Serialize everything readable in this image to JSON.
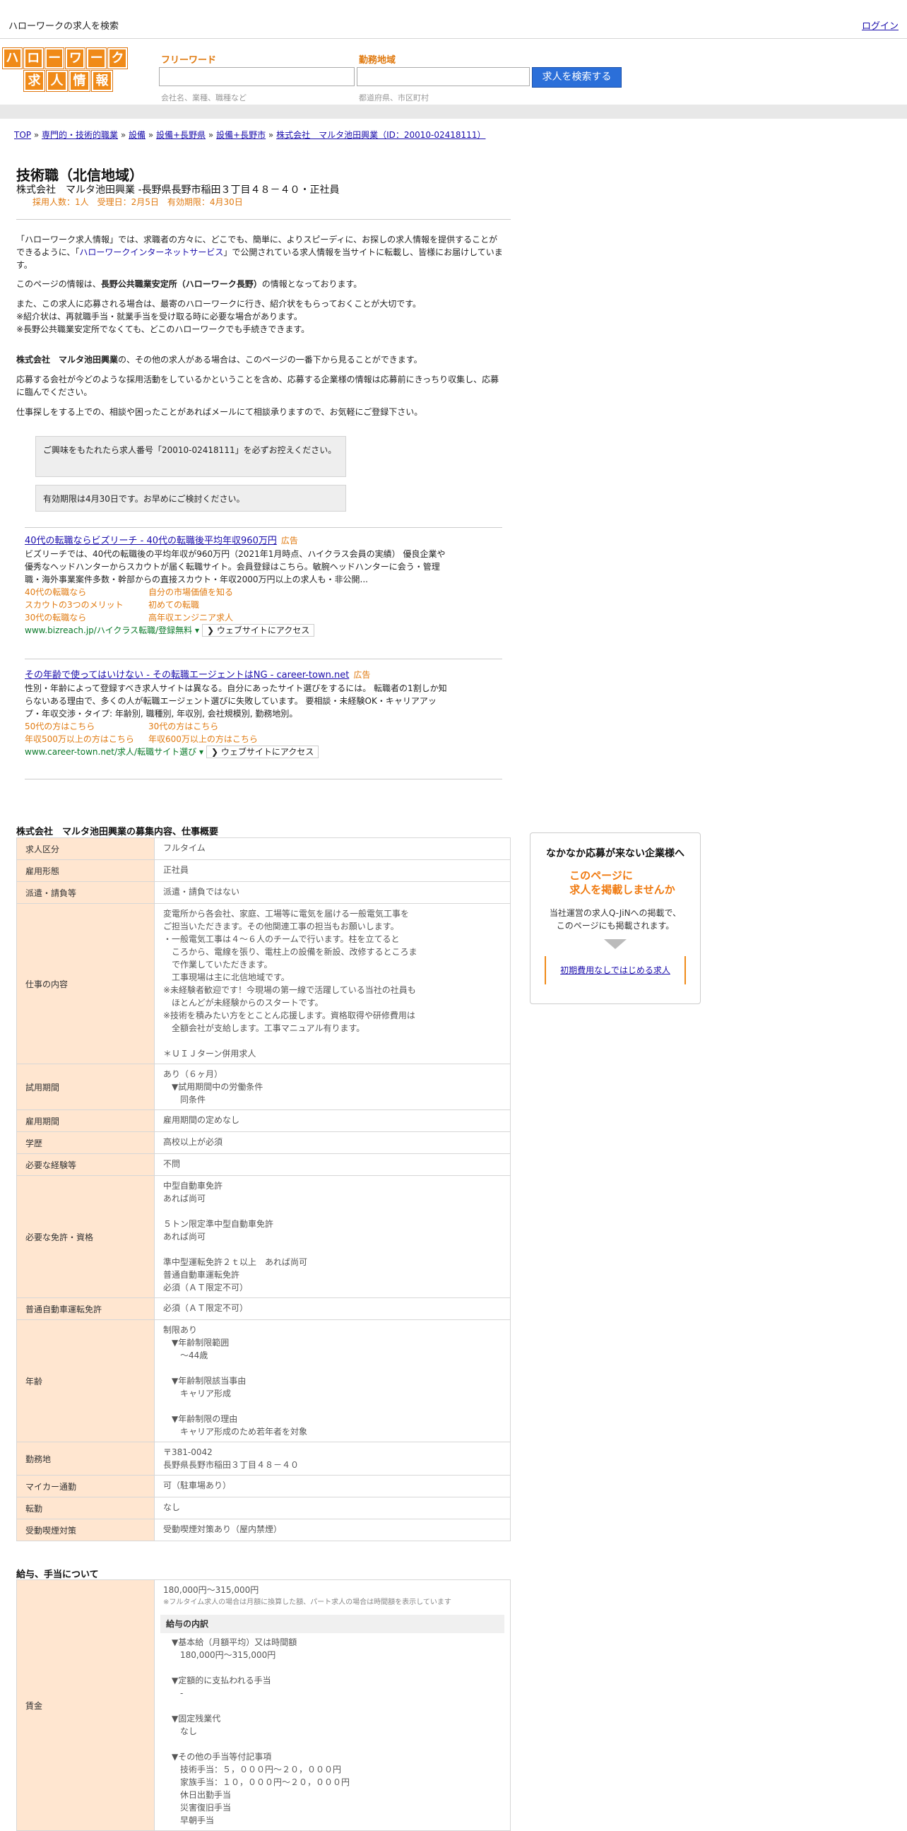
{
  "header": {
    "site_title": "ハローワークの求人を検索",
    "login": "ログイン",
    "logo_row1": [
      "ハ",
      "ロ",
      "ー",
      "ワ",
      "ー",
      "ク"
    ],
    "logo_row2": [
      "求",
      "人",
      "情",
      "報"
    ]
  },
  "search": {
    "freeword_label": "フリーワード",
    "freeword_hint": "会社名、業種、職種など",
    "area_label": "勤務地域",
    "area_hint": "都道府県、市区町村",
    "button": "求人を検索する"
  },
  "breadcrumb": [
    "TOP",
    "専門的・技術的職業",
    "設備",
    "設備+長野県",
    "設備+長野市",
    "株式会社　マルタ池田興業（ID：20010-02418111）"
  ],
  "job": {
    "title": "技術職（北信地域）",
    "company_line": "株式会社　マルタ池田興業 -長野県長野市稲田３丁目４８－４０・正社員",
    "meta": "採用人数：1人　受理日：2月5日　有効期限：4月30日"
  },
  "intro": {
    "p1_a": "「ハローワーク求人情報」では、求職者の方々に、どこでも、簡単に、よりスピーディに、お探しの求人情報を提供することができるように、「",
    "p1_link": "ハローワークインターネットサービス",
    "p1_b": "」で公開されている求人情報を当サイトに転載し、皆様にお届けしています。",
    "p2_a": "このページの情報は、",
    "p2_bold": "長野公共職業安定所（ハローワーク長野）",
    "p2_b": "の情報となっております。",
    "p3": "また、この求人に応募される場合は、最寄のハローワークに行き、紹介状をもらっておくことが大切です。",
    "p4": "※紹介状は、再就職手当・就業手当を受け取る時に必要な場合があります。",
    "p5": "※長野公共職業安定所でなくても、どこのハローワークでも手続きできます。",
    "p6_bold": "株式会社　マルタ池田興業",
    "p6": "の、その他の求人がある場合は、このページの一番下から見ることができます。",
    "p7": "応募する会社が今どのような採用活動をしているかということを含め、応募する企業様の情報は応募前にきっちり収集し、応募に臨んでください。",
    "p8": "仕事探しをする上での、相談や困ったことがあればメールにて相談承りますので、お気軽にご登録下さい。"
  },
  "notices": {
    "n1": "ご興味をもたれたら求人番号「20010-02418111」を必ずお控えください。",
    "n2": "有効期限は4月30日です。お早めにご検討ください。"
  },
  "ads": [
    {
      "title": "40代の転職ならビズリーチ - 40代の転職後平均年収960万円",
      "tag": "広告",
      "body": "ビズリーチでは、40代の転職後の平均年収が960万円（2021年1月時点、ハイクラス会員の実績） 優良企業や優秀なヘッドハンターからスカウトが届く転職サイト。会員登録はこちら。敏腕ヘッドハンターに会う・管理職・海外事業案件多数・幹部からの直接スカウト・年収2000万円以上の求人も・非公開...",
      "links": [
        "40代の転職なら",
        "自分の市場価値を知る",
        "スカウトの3つのメリット",
        "初めての転職",
        "30代の転職なら",
        "高年収エンジニア求人"
      ],
      "url": "www.bizreach.jp/ハイクラス転職/登録無料",
      "visit": "❯ ウェブサイトにアクセス"
    },
    {
      "title": "その年齢で使ってはいけない - その転職エージェントはNG - career-town.net",
      "tag": "広告",
      "body": "性別・年齢によって登録すべき求人サイトは異なる。自分にあったサイト選びをするには。 転職者の1割しか知らないある理由で、多くの人が転職エージェント選びに失敗しています。 要相談・未経験OK・キャリアアップ・年収交渉・タイプ: 年齢別, 職種別, 年収別, 会社規模別, 勤務地別。",
      "links": [
        "50代の方はこちら",
        "30代の方はこちら",
        "年収500万以上の方はこちら",
        "年収600万以上の方はこちら"
      ],
      "url": "www.career-town.net/求人/転職サイト選び",
      "visit": "❯ ウェブサイトにアクセス"
    }
  ],
  "details": {
    "section_title": "株式会社　マルタ池田興業の募集内容、仕事概要",
    "rows": [
      {
        "label": "求人区分",
        "value": "フルタイム"
      },
      {
        "label": "雇用形態",
        "value": "正社員"
      },
      {
        "label": "派遣・請負等",
        "value": "派遣・請負ではない"
      },
      {
        "label": "仕事の内容",
        "value": "変電所から各会社、家庭、工場等に電気を届ける一般電気工事を\nご担当いただきます。その他関連工事の担当もお願いします。\n・一般電気工事は４～６人のチームで行います。柱を立てると\n　ころから、電線を張り、電柱上の設備を新設、改修するところま\n　で作業していただきます。\n　工事現場は主に北信地域です。\n※未経験者歓迎です！今現場の第一線で活躍している当社の社員も\n　ほとんどが未経験からのスタートです。\n※技術を積みたい方をとことん応援します。資格取得や研修費用は\n　全額会社が支給します。工事マニュアル有ります。\n\n＊ＵＩＪターン併用求人"
      },
      {
        "label": "試用期間",
        "value": "あり（６ヶ月）\n　▼試用期間中の労働条件\n　　同条件"
      },
      {
        "label": "雇用期間",
        "value": "雇用期間の定めなし"
      },
      {
        "label": "学歴",
        "value": "高校以上が必須"
      },
      {
        "label": "必要な経験等",
        "value": "不問"
      },
      {
        "label": "必要な免許・資格",
        "value": "中型自動車免許\nあれば尚可\n\n５トン限定準中型自動車免許\nあれば尚可\n\n準中型運転免許２ｔ以上　あれば尚可\n普通自動車運転免許\n必須（ＡＴ限定不可）"
      },
      {
        "label": "普通自動車運転免許",
        "value": "必須（ＡＴ限定不可）"
      },
      {
        "label": "年齢",
        "value": "制限あり\n　▼年齢制限範囲\n　　～44歳\n\n　▼年齢制限該当事由\n　　キャリア形成\n\n　▼年齢制限の理由\n　　キャリア形成のため若年者を対象"
      },
      {
        "label": "勤務地",
        "value": "〒381-0042\n長野県長野市稲田３丁目４８－４０"
      },
      {
        "label": "マイカー通勤",
        "value": "可（駐車場あり）"
      },
      {
        "label": "転勤",
        "value": "なし"
      },
      {
        "label": "受動喫煙対策",
        "value": "受動喫煙対策あり（屋内禁煙）"
      }
    ]
  },
  "wage": {
    "section_title": "給与、手当について",
    "label": "賃金",
    "range": "180,000円〜315,000円",
    "note": "※フルタイム求人の場合は月額に換算した額、パート求人の場合は時間額を表示しています",
    "inner_title": "給与の内訳",
    "breakdown": "　▼基本給（月額平均）又は時間額\n　　180,000円〜315,000円\n\n　▼定額的に支払われる手当\n　　-\n\n　▼固定残業代\n　　なし\n\n　▼その他の手当等付記事項\n　　技術手当：５，０００円～２０，０００円\n　　家族手当：１０，０００円～２０，０００円\n　　休日出勤手当\n　　災害復旧手当\n　　早朝手当"
  },
  "side": {
    "title": "なかなか応募が来ない企業様へ",
    "orange1": "このページに",
    "orange2": "求人を掲載しませんか",
    "text1": "当社運営の求人Q-JiNへの掲載で、",
    "text2": "このページにも掲載されます。",
    "link": "初期費用なしではじめる求人"
  }
}
